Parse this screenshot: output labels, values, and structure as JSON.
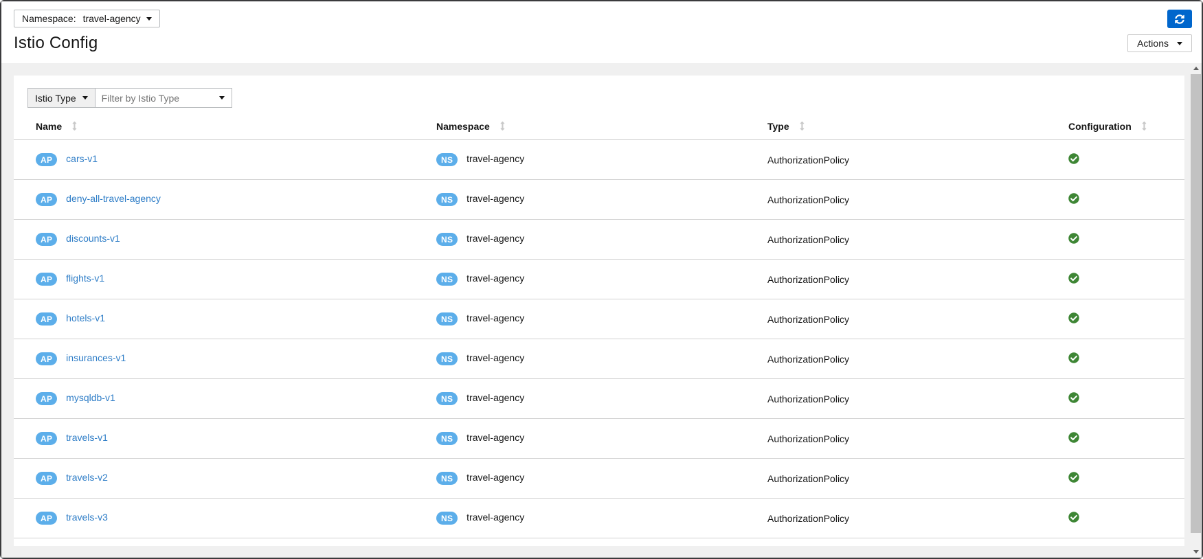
{
  "page": {
    "namespace_selector": {
      "label": "Namespace:",
      "value": "travel-agency"
    },
    "title": "Istio Config",
    "actions_label": "Actions"
  },
  "toolbar": {
    "type_button_label": "Istio Type",
    "filter_placeholder": "Filter by Istio Type"
  },
  "table": {
    "columns": [
      "Name",
      "Namespace",
      "Type",
      "Configuration"
    ],
    "rows": [
      {
        "badge": "AP",
        "name": "cars-v1",
        "ns_badge": "NS",
        "namespace": "travel-agency",
        "type": "AuthorizationPolicy",
        "config_status": "valid"
      },
      {
        "badge": "AP",
        "name": "deny-all-travel-agency",
        "ns_badge": "NS",
        "namespace": "travel-agency",
        "type": "AuthorizationPolicy",
        "config_status": "valid"
      },
      {
        "badge": "AP",
        "name": "discounts-v1",
        "ns_badge": "NS",
        "namespace": "travel-agency",
        "type": "AuthorizationPolicy",
        "config_status": "valid"
      },
      {
        "badge": "AP",
        "name": "flights-v1",
        "ns_badge": "NS",
        "namespace": "travel-agency",
        "type": "AuthorizationPolicy",
        "config_status": "valid"
      },
      {
        "badge": "AP",
        "name": "hotels-v1",
        "ns_badge": "NS",
        "namespace": "travel-agency",
        "type": "AuthorizationPolicy",
        "config_status": "valid"
      },
      {
        "badge": "AP",
        "name": "insurances-v1",
        "ns_badge": "NS",
        "namespace": "travel-agency",
        "type": "AuthorizationPolicy",
        "config_status": "valid"
      },
      {
        "badge": "AP",
        "name": "mysqldb-v1",
        "ns_badge": "NS",
        "namespace": "travel-agency",
        "type": "AuthorizationPolicy",
        "config_status": "valid"
      },
      {
        "badge": "AP",
        "name": "travels-v1",
        "ns_badge": "NS",
        "namespace": "travel-agency",
        "type": "AuthorizationPolicy",
        "config_status": "valid"
      },
      {
        "badge": "AP",
        "name": "travels-v2",
        "ns_badge": "NS",
        "namespace": "travel-agency",
        "type": "AuthorizationPolicy",
        "config_status": "valid"
      },
      {
        "badge": "AP",
        "name": "travels-v3",
        "ns_badge": "NS",
        "namespace": "travel-agency",
        "type": "AuthorizationPolicy",
        "config_status": "valid"
      }
    ]
  },
  "colors": {
    "primary_blue": "#0066cc",
    "badge_blue": "#5caeea",
    "link_blue": "#2e7dc7",
    "success_green": "#3e8635",
    "page_background": "#f0f0f0"
  }
}
